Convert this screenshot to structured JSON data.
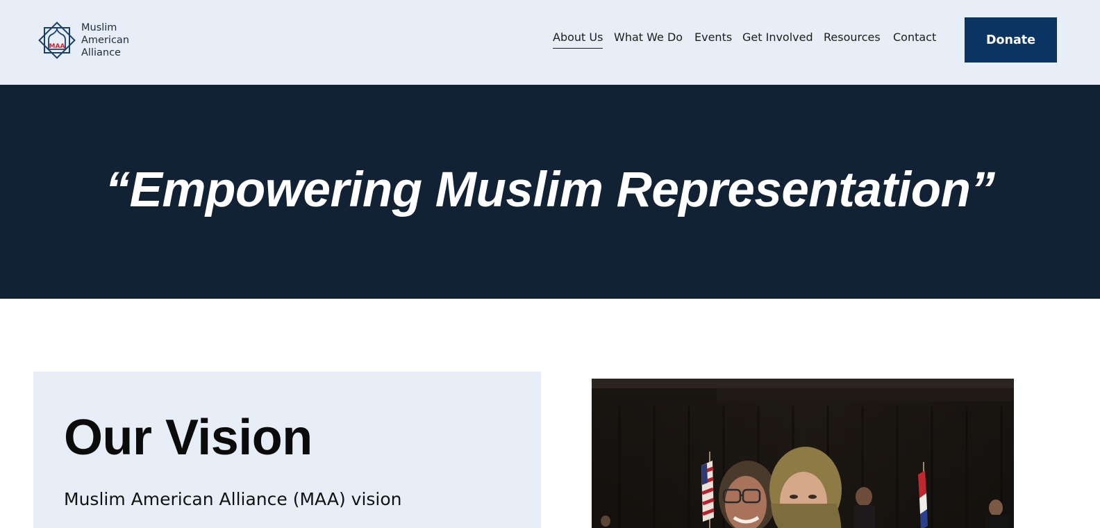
{
  "header": {
    "logo": {
      "mark_text": "MAA",
      "lines": [
        "Muslim",
        "American",
        "Alliance"
      ]
    },
    "nav": [
      {
        "label": "About Us",
        "active": true
      },
      {
        "label": "What We Do",
        "active": false
      },
      {
        "label": "Events",
        "active": false
      },
      {
        "label": "Get Involved",
        "active": false
      },
      {
        "label": "Resources",
        "active": false
      },
      {
        "label": "Contact",
        "active": false
      }
    ],
    "donate_label": "Donate"
  },
  "hero": {
    "quote": "“Empowering Muslim Representation”"
  },
  "vision": {
    "title": "Our Vision",
    "text": "Muslim American Alliance (MAA) vision"
  },
  "colors": {
    "header_bg": "#e8eef7",
    "hero_bg": "#122235",
    "donate_bg": "#0a3563",
    "logo_accent": "#d4232e",
    "logo_blue": "#1b3f6b"
  }
}
